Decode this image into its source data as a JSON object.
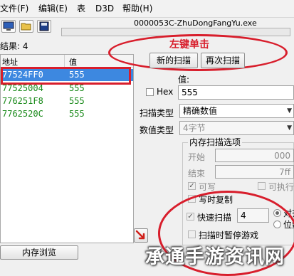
{
  "menubar": {
    "items": [
      "文件(F)",
      "编辑(E)",
      "表",
      "D3D",
      "帮助(H)"
    ]
  },
  "toolbar": {
    "process_title": "0000053C-ZhuDongFangYu.exe",
    "icons": [
      "computer-icon",
      "open-folder-icon",
      "save-disk-icon"
    ]
  },
  "results": {
    "found_label": "结果: 4",
    "columns": [
      "地址",
      "值"
    ],
    "rows": [
      {
        "address": "77524FF0",
        "value": "555"
      },
      {
        "address": "77525004",
        "value": "555"
      },
      {
        "address": "776251F8",
        "value": "555"
      },
      {
        "address": "7762520C",
        "value": "555"
      }
    ]
  },
  "annotation": {
    "text": "左键单击",
    "color": "#d81e2c"
  },
  "scan": {
    "first_scan": "新的扫描",
    "next_scan": "再次扫描",
    "value_label": "值:",
    "hex_label": "Hex",
    "value_input": "555",
    "scan_type_label": "扫描类型",
    "scan_type_value": "精确数值",
    "value_type_label": "数值类型",
    "value_type_value": "4字节"
  },
  "memory_options": {
    "title": "内存扫描选项",
    "start_label": "开始",
    "start_value": "000",
    "stop_label": "结束",
    "stop_value": "7ff",
    "writable_label": "可写",
    "executable_label": "可执行",
    "copy_on_write_label": "写时复制",
    "fast_scan_label": "快速扫描",
    "fast_scan_value": "4",
    "align_label": "对齐",
    "last_digits_label": "位数",
    "pause_label": "扫描时暂停游戏"
  },
  "bottom": {
    "memory_view_button": "内存浏览"
  },
  "watermark": "承通手游资讯网"
}
